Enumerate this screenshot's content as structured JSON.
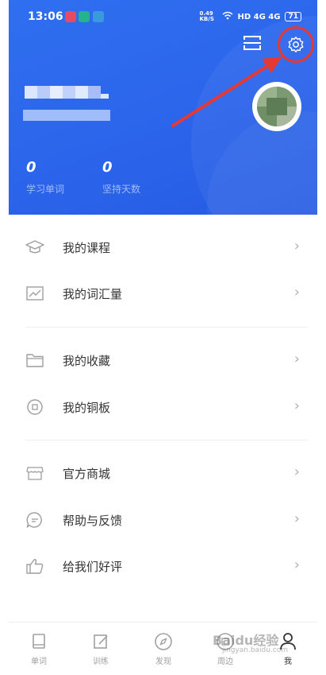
{
  "status_bar": {
    "time": "13:06",
    "speed": "0.49 KB/S",
    "network": "HD 4G 4G",
    "battery": "71"
  },
  "header": {
    "stats": [
      {
        "value": "0",
        "label": "学习单词"
      },
      {
        "value": "0",
        "label": "坚持天数"
      }
    ]
  },
  "menu": [
    {
      "label": "我的课程",
      "icon": "graduation-cap-icon"
    },
    {
      "label": "我的词汇量",
      "icon": "chart-line-icon"
    },
    {
      "label": "我的收藏",
      "icon": "folder-icon"
    },
    {
      "label": "我的铜板",
      "icon": "coin-icon"
    },
    {
      "label": "官方商城",
      "icon": "store-icon"
    },
    {
      "label": "帮助与反馈",
      "icon": "chat-icon"
    },
    {
      "label": "给我们好评",
      "icon": "thumbs-up-icon"
    }
  ],
  "tabbar": [
    {
      "label": "单词",
      "icon": "book-icon"
    },
    {
      "label": "训练",
      "icon": "pencil-icon"
    },
    {
      "label": "发现",
      "icon": "compass-icon"
    },
    {
      "label": "周边",
      "icon": "shop-icon"
    },
    {
      "label": "我",
      "icon": "person-icon",
      "active": true
    }
  ],
  "watermark": {
    "text": "Baidu经验",
    "sub": "jingyan.baidu.com"
  },
  "colors": {
    "header_blue": "#2b64ea",
    "highlight_red": "#e53935"
  }
}
